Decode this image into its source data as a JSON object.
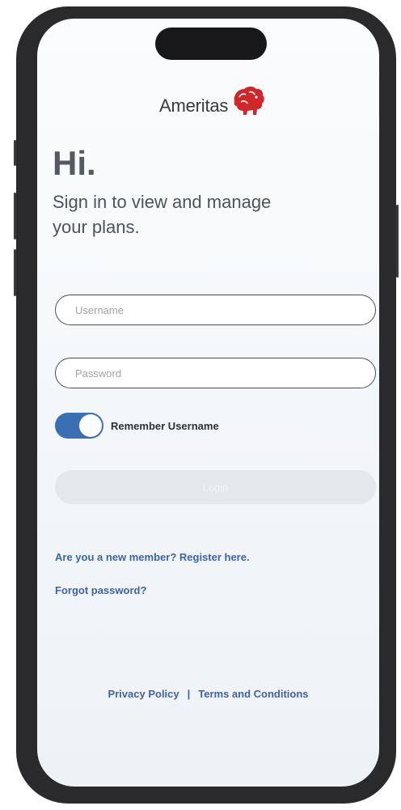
{
  "brand": {
    "name": "Ameritas",
    "logo_icon": "lion-icon",
    "accent": "#d0272b"
  },
  "header": {
    "greeting": "Hi.",
    "subtitle": "Sign in to view and manage your plans."
  },
  "form": {
    "username_placeholder": "Username",
    "password_placeholder": "Password",
    "remember_label": "Remember Username",
    "remember_on": true,
    "login_label": "Login"
  },
  "links": {
    "register": "Are you a new member? Register here.",
    "forgot": "Forgot password?"
  },
  "footer": {
    "privacy": "Privacy Policy",
    "separator": "|",
    "terms": "Terms and Conditions"
  },
  "colors": {
    "primary": "#3a6fb4",
    "link": "#3d63a6",
    "frame": "#2a2a2c"
  }
}
